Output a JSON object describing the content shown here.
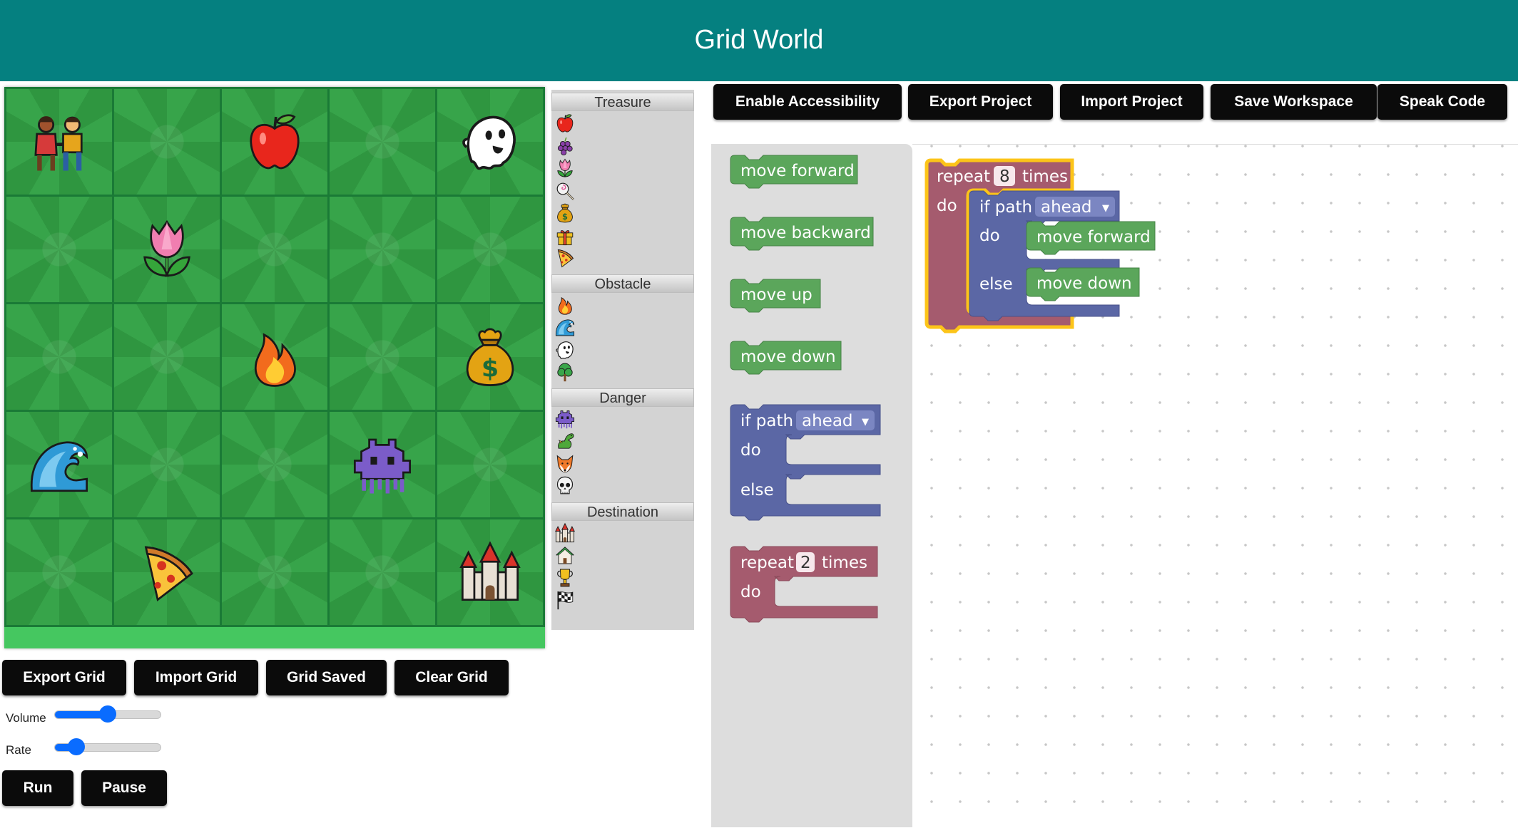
{
  "header": {
    "title": "Grid World"
  },
  "grid": {
    "rows": [
      [
        "couple",
        "",
        "apple",
        "",
        "ghost"
      ],
      [
        "",
        "tulip",
        "",
        "",
        ""
      ],
      [
        "",
        "",
        "fire",
        "",
        "money-bag"
      ],
      [
        "wave",
        "",
        "",
        "alien-monster",
        ""
      ],
      [
        "",
        "pizza",
        "",
        "",
        "castle"
      ]
    ]
  },
  "palette": {
    "categories": [
      {
        "label": "Treasure",
        "items": [
          "apple",
          "grapes",
          "tulip",
          "lollipop",
          "money-bag",
          "gift",
          "pizza"
        ]
      },
      {
        "label": "Obstacle",
        "items": [
          "fire",
          "wave",
          "ghost",
          "tree"
        ]
      },
      {
        "label": "Danger",
        "items": [
          "alien-monster",
          "dragon",
          "fox",
          "skull"
        ]
      },
      {
        "label": "Destination",
        "items": [
          "castle",
          "house",
          "trophy",
          "chequered-flag"
        ]
      }
    ]
  },
  "grid_buttons": {
    "export": "Export Grid",
    "import": "Import Grid",
    "saved": "Grid Saved",
    "clear": "Clear Grid"
  },
  "sliders": {
    "volume": {
      "label": "Volume",
      "value": 0.5
    },
    "rate": {
      "label": "Rate",
      "value": 0.2
    }
  },
  "run_buttons": {
    "run": "Run",
    "pause": "Pause"
  },
  "toolbar": {
    "accessibility": "Enable Accessibility",
    "export_project": "Export Project",
    "import_project": "Import Project",
    "save_workspace": "Save Workspace",
    "speak_code": "Speak Code"
  },
  "flyout": {
    "move_forward": "move forward",
    "move_backward": "move backward",
    "move_up": "move up",
    "move_down": "move down",
    "if_path": "if path",
    "if_dropdown": "ahead",
    "do": "do",
    "else": "else",
    "repeat": "repeat",
    "repeat_count": "2",
    "times": "times"
  },
  "workspace": {
    "repeat": "repeat",
    "repeat_count": "8",
    "times": "times",
    "do": "do",
    "if_path": "if path",
    "if_dropdown": "ahead",
    "inner_do": "do",
    "else": "else",
    "then_block": "move forward",
    "else_block": "move down"
  },
  "colors": {
    "header": "#058080",
    "move_block": "#5ba65b",
    "logic_block": "#5b67a5",
    "loop_block": "#a55b6e",
    "selected_outline": "#fcc419"
  }
}
